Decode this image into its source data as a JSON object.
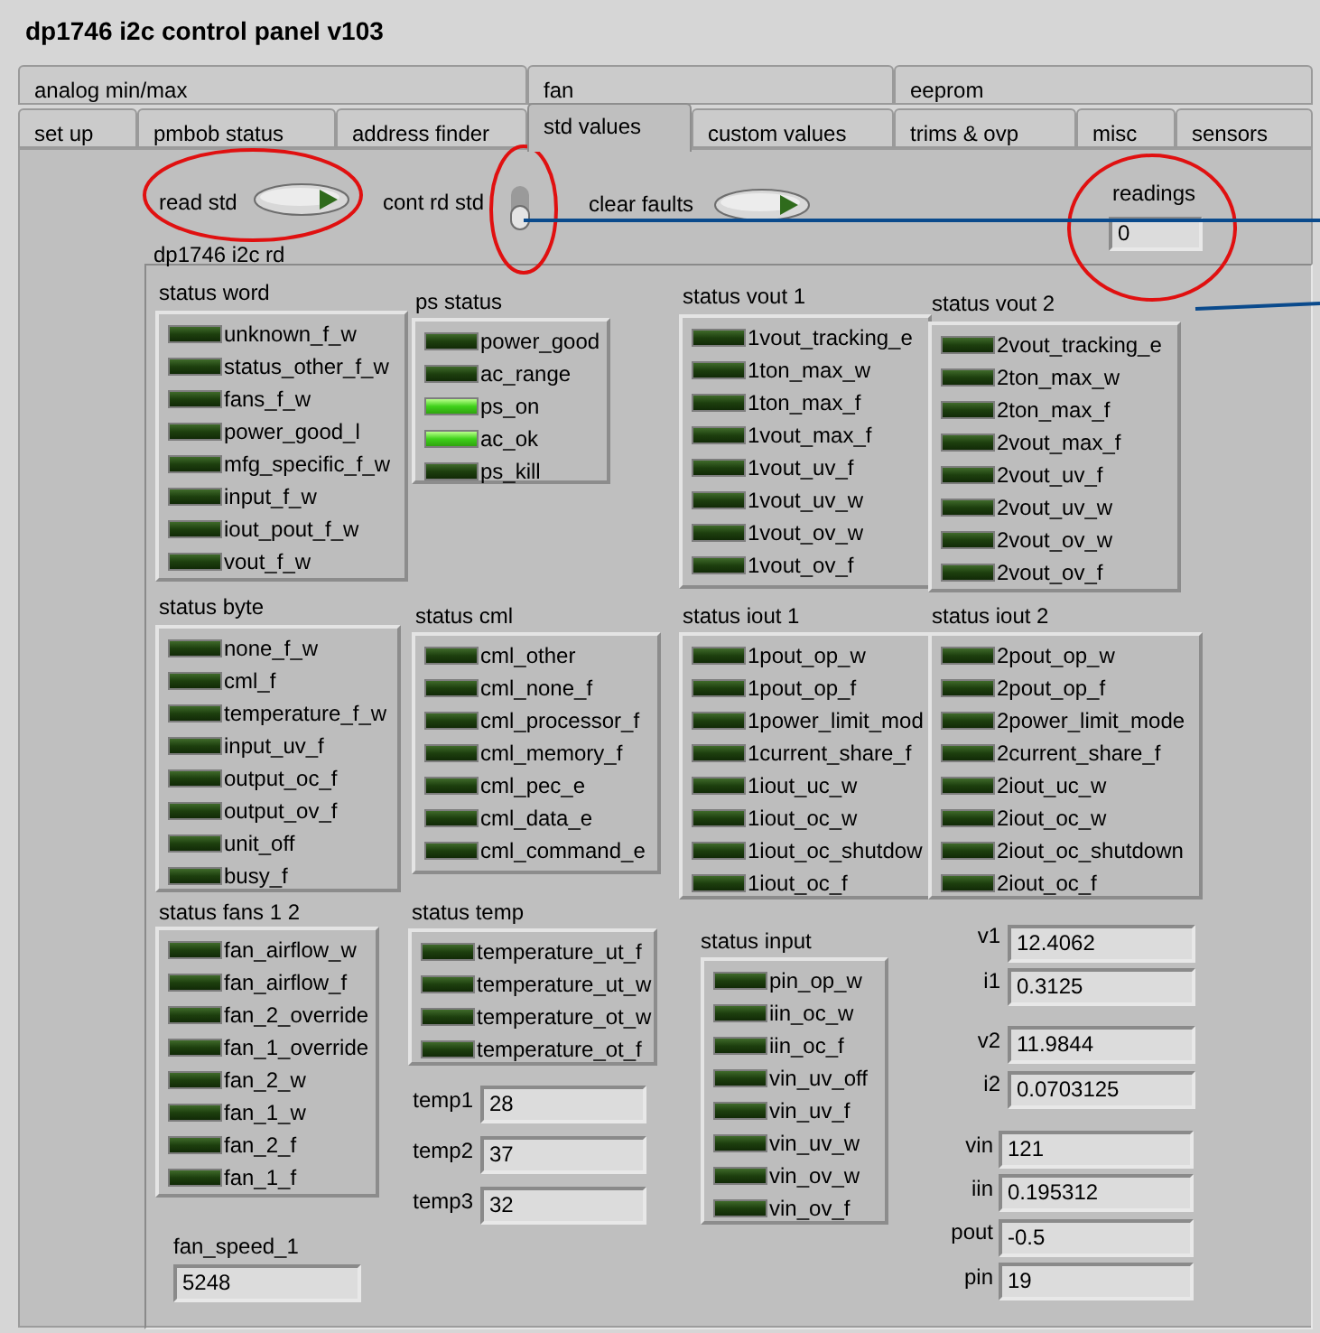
{
  "window": {
    "title": "dp1746 i2c control panel v103"
  },
  "tab_rows": [
    [
      {
        "label": "analog min/max",
        "selected": false
      },
      {
        "label": "fan",
        "selected": false
      },
      {
        "label": "eeprom",
        "selected": false
      }
    ],
    [
      {
        "label": "set up",
        "selected": false
      },
      {
        "label": "pmbob status",
        "selected": false
      },
      {
        "label": "address finder",
        "selected": false
      },
      {
        "label": "std values",
        "selected": true
      },
      {
        "label": "custom values",
        "selected": false
      },
      {
        "label": "trims & ovp",
        "selected": false
      },
      {
        "label": "misc",
        "selected": false
      },
      {
        "label": "sensors",
        "selected": false
      }
    ]
  ],
  "buttons": [
    {
      "label": "read std"
    },
    {
      "label": "clear faults"
    }
  ],
  "switch": {
    "label": "cont rd std",
    "on": false
  },
  "readings": {
    "label": "readings",
    "value": "0"
  },
  "cluster_label": "dp1746 i2c rd",
  "groups": [
    {
      "title": "status word",
      "leds": [
        {
          "label": "unknown_f_w",
          "on": false
        },
        {
          "label": "status_other_f_w",
          "on": false
        },
        {
          "label": "fans_f_w",
          "on": false
        },
        {
          "label": "power_good_l",
          "on": false
        },
        {
          "label": "mfg_specific_f_w",
          "on": false
        },
        {
          "label": "input_f_w",
          "on": false
        },
        {
          "label": "iout_pout_f_w",
          "on": false
        },
        {
          "label": "vout_f_w",
          "on": false
        }
      ]
    },
    {
      "title": "ps status",
      "leds": [
        {
          "label": "power_good",
          "on": false
        },
        {
          "label": "ac_range",
          "on": false
        },
        {
          "label": "ps_on",
          "on": true
        },
        {
          "label": "ac_ok",
          "on": true
        },
        {
          "label": "ps_kill",
          "on": false
        }
      ]
    },
    {
      "title": "status vout 1",
      "leds": [
        {
          "label": "1vout_tracking_e",
          "on": false
        },
        {
          "label": "1ton_max_w",
          "on": false
        },
        {
          "label": "1ton_max_f",
          "on": false
        },
        {
          "label": "1vout_max_f",
          "on": false
        },
        {
          "label": "1vout_uv_f",
          "on": false
        },
        {
          "label": "1vout_uv_w",
          "on": false
        },
        {
          "label": "1vout_ov_w",
          "on": false
        },
        {
          "label": "1vout_ov_f",
          "on": false
        }
      ]
    },
    {
      "title": "status vout 2",
      "leds": [
        {
          "label": "2vout_tracking_e",
          "on": false
        },
        {
          "label": "2ton_max_w",
          "on": false
        },
        {
          "label": "2ton_max_f",
          "on": false
        },
        {
          "label": "2vout_max_f",
          "on": false
        },
        {
          "label": "2vout_uv_f",
          "on": false
        },
        {
          "label": "2vout_uv_w",
          "on": false
        },
        {
          "label": "2vout_ov_w",
          "on": false
        },
        {
          "label": "2vout_ov_f",
          "on": false
        }
      ]
    },
    {
      "title": "status byte",
      "leds": [
        {
          "label": "none_f_w",
          "on": false
        },
        {
          "label": "cml_f",
          "on": false
        },
        {
          "label": "temperature_f_w",
          "on": false
        },
        {
          "label": "input_uv_f",
          "on": false
        },
        {
          "label": "output_oc_f",
          "on": false
        },
        {
          "label": "output_ov_f",
          "on": false
        },
        {
          "label": "unit_off",
          "on": false
        },
        {
          "label": "busy_f",
          "on": false
        }
      ]
    },
    {
      "title": "status cml",
      "leds": [
        {
          "label": "cml_other",
          "on": false
        },
        {
          "label": "cml_none_f",
          "on": false
        },
        {
          "label": "cml_processor_f",
          "on": false
        },
        {
          "label": "cml_memory_f",
          "on": false
        },
        {
          "label": "cml_pec_e",
          "on": false
        },
        {
          "label": "cml_data_e",
          "on": false
        },
        {
          "label": "cml_command_e",
          "on": false
        }
      ]
    },
    {
      "title": "status iout 1",
      "leds": [
        {
          "label": "1pout_op_w",
          "on": false
        },
        {
          "label": "1pout_op_f",
          "on": false
        },
        {
          "label": "1power_limit_mod",
          "on": false
        },
        {
          "label": "1current_share_f",
          "on": false
        },
        {
          "label": "1iout_uc_w",
          "on": false
        },
        {
          "label": "1iout_oc_w",
          "on": false
        },
        {
          "label": "1iout_oc_shutdow",
          "on": false
        },
        {
          "label": "1iout_oc_f",
          "on": false
        }
      ]
    },
    {
      "title": "status iout 2",
      "leds": [
        {
          "label": "2pout_op_w",
          "on": false
        },
        {
          "label": "2pout_op_f",
          "on": false
        },
        {
          "label": "2power_limit_mode",
          "on": false
        },
        {
          "label": "2current_share_f",
          "on": false
        },
        {
          "label": "2iout_uc_w",
          "on": false
        },
        {
          "label": "2iout_oc_w",
          "on": false
        },
        {
          "label": "2iout_oc_shutdown",
          "on": false
        },
        {
          "label": "2iout_oc_f",
          "on": false
        }
      ]
    },
    {
      "title": "status fans 1 2",
      "leds": [
        {
          "label": "fan_airflow_w",
          "on": false
        },
        {
          "label": "fan_airflow_f",
          "on": false
        },
        {
          "label": "fan_2_override",
          "on": false
        },
        {
          "label": "fan_1_override",
          "on": false
        },
        {
          "label": "fan_2_w",
          "on": false
        },
        {
          "label": "fan_1_w",
          "on": false
        },
        {
          "label": "fan_2_f",
          "on": false
        },
        {
          "label": "fan_1_f",
          "on": false
        }
      ]
    },
    {
      "title": "status temp",
      "leds": [
        {
          "label": "temperature_ut_f",
          "on": false
        },
        {
          "label": "temperature_ut_w",
          "on": false
        },
        {
          "label": "temperature_ot_w",
          "on": false
        },
        {
          "label": "temperature_ot_f",
          "on": false
        }
      ]
    },
    {
      "title": "status input",
      "leds": [
        {
          "label": "pin_op_w",
          "on": false
        },
        {
          "label": "iin_oc_w",
          "on": false
        },
        {
          "label": "iin_oc_f",
          "on": false
        },
        {
          "label": "vin_uv_off",
          "on": false
        },
        {
          "label": "vin_uv_f",
          "on": false
        },
        {
          "label": "vin_uv_w",
          "on": false
        },
        {
          "label": "vin_ov_w",
          "on": false
        },
        {
          "label": "vin_ov_f",
          "on": false
        }
      ]
    }
  ],
  "numerics": [
    {
      "label": "temp1",
      "value": "28"
    },
    {
      "label": "temp2",
      "value": "37"
    },
    {
      "label": "temp3",
      "value": "32"
    },
    {
      "label": "v1",
      "value": "12.4062"
    },
    {
      "label": "i1",
      "value": "0.3125"
    },
    {
      "label": "v2",
      "value": "11.9844"
    },
    {
      "label": "i2",
      "value": "0.0703125"
    },
    {
      "label": "vin",
      "value": "121"
    },
    {
      "label": "iin",
      "value": "0.195312"
    },
    {
      "label": "pout",
      "value": "-0.5"
    },
    {
      "label": "pin",
      "value": "19"
    },
    {
      "label": "fan_speed_1",
      "value": "5248"
    }
  ]
}
